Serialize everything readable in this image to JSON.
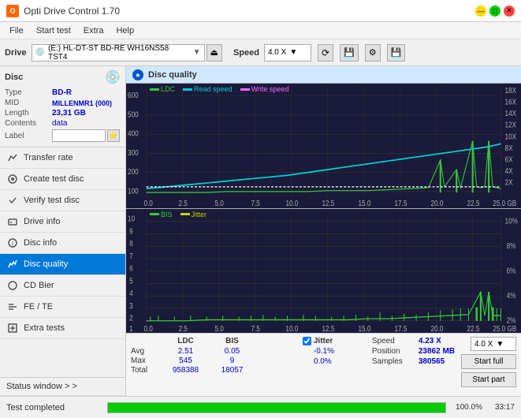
{
  "titleBar": {
    "title": "Opti Drive Control 1.70",
    "minimizeLabel": "—",
    "maximizeLabel": "□",
    "closeLabel": "✕"
  },
  "menuBar": {
    "items": [
      "File",
      "Start test",
      "Extra",
      "Help"
    ]
  },
  "driveBar": {
    "driveLabel": "Drive",
    "driveValue": "(E:)  HL-DT-ST BD-RE  WH16NS58 TST4",
    "speedLabel": "Speed",
    "speedValue": "4.0 X"
  },
  "disc": {
    "title": "Disc",
    "typeLabel": "Type",
    "typeValue": "BD-R",
    "midLabel": "MID",
    "midValue": "MILLENMR1 (000)",
    "lengthLabel": "Length",
    "lengthValue": "23,31 GB",
    "contentsLabel": "Contents",
    "contentsValue": "data",
    "labelLabel": "Label",
    "labelValue": ""
  },
  "navItems": [
    {
      "id": "transfer-rate",
      "label": "Transfer rate",
      "icon": "chart-icon"
    },
    {
      "id": "create-test-disc",
      "label": "Create test disc",
      "icon": "disc-icon"
    },
    {
      "id": "verify-test-disc",
      "label": "Verify test disc",
      "icon": "check-icon"
    },
    {
      "id": "drive-info",
      "label": "Drive info",
      "icon": "info-icon"
    },
    {
      "id": "disc-info",
      "label": "Disc info",
      "icon": "disc-info-icon"
    },
    {
      "id": "disc-quality",
      "label": "Disc quality",
      "icon": "quality-icon",
      "active": true
    },
    {
      "id": "cd-bier",
      "label": "CD Bier",
      "icon": "cd-icon"
    },
    {
      "id": "fe-te",
      "label": "FE / TE",
      "icon": "fe-icon"
    },
    {
      "id": "extra-tests",
      "label": "Extra tests",
      "icon": "extra-icon"
    }
  ],
  "statusWindow": {
    "label": "Status window > >",
    "progress": 100,
    "progressText": "100.0%",
    "time": "33:17"
  },
  "discQuality": {
    "title": "Disc quality",
    "legend": {
      "ldc": "LDC",
      "readSpeed": "Read speed",
      "writeSpeed": "Write speed",
      "bis": "BIS",
      "jitter": "Jitter"
    }
  },
  "stats": {
    "headers": [
      "LDC",
      "BIS",
      "",
      "Jitter",
      "Speed",
      ""
    ],
    "rows": [
      {
        "label": "Avg",
        "ldc": "2.51",
        "bis": "0.05",
        "jitter": "-0.1%",
        "speed": "4.23 X",
        "speedDropdown": "4.0 X"
      },
      {
        "label": "Max",
        "ldc": "545",
        "bis": "9",
        "jitter": "0.0%",
        "position": "23862 MB"
      },
      {
        "label": "Total",
        "ldc": "958388",
        "bis": "18057",
        "samples": "380565"
      }
    ],
    "buttons": [
      "Start full",
      "Start part"
    ],
    "jitterChecked": true,
    "speedLabel": "Speed",
    "speedValue": "4.23 X",
    "positionLabel": "Position",
    "positionValue": "23862 MB",
    "samplesLabel": "Samples",
    "samplesValue": "380565",
    "speedDropdownValue": "4.0 X"
  },
  "chart": {
    "topYMax": 600,
    "topYLabels": [
      "600",
      "500",
      "400",
      "300",
      "200",
      "100"
    ],
    "topYRight": [
      "18X",
      "16X",
      "14X",
      "12X",
      "10X",
      "8X",
      "6X",
      "4X",
      "2X"
    ],
    "bottomYLabels": [
      "10",
      "9",
      "8",
      "7",
      "6",
      "5",
      "4",
      "3",
      "2",
      "1"
    ],
    "bottomYRight": [
      "10%",
      "8%",
      "6%",
      "4%",
      "2%"
    ],
    "xLabels": [
      "0.0",
      "2.5",
      "5.0",
      "7.5",
      "10.0",
      "12.5",
      "15.0",
      "17.5",
      "20.0",
      "22.5",
      "25.0 GB"
    ]
  },
  "statusText": "Test completed"
}
